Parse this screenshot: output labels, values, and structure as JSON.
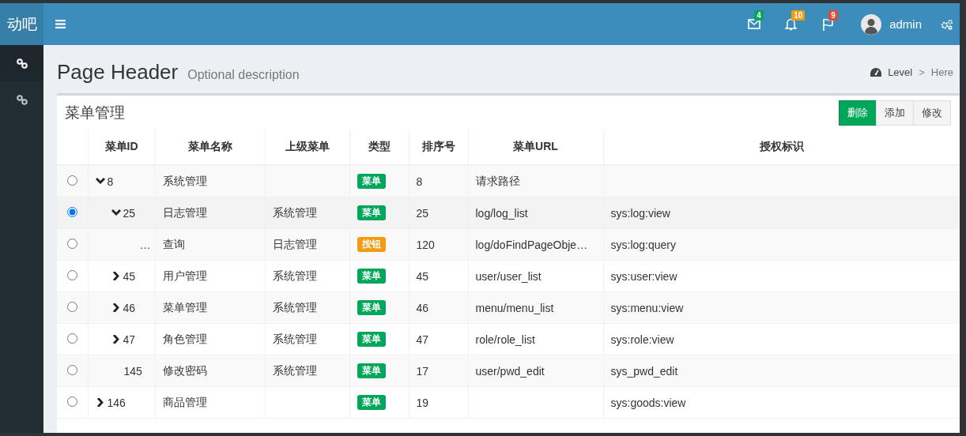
{
  "header": {
    "logo": "动吧",
    "notifications": [
      {
        "kind": "mail",
        "count": "4",
        "color": "#00a65a"
      },
      {
        "kind": "bell",
        "count": "10",
        "color": "#f39c12"
      },
      {
        "kind": "flag",
        "count": "9",
        "color": "#dd4b39"
      }
    ],
    "user": {
      "name": "admin"
    }
  },
  "sidebar": {
    "items": [
      {
        "selected": true
      },
      {
        "selected": false
      }
    ]
  },
  "page_header": {
    "title": "Page Header",
    "description": "Optional description"
  },
  "breadcrumb": {
    "separator": ">",
    "items": [
      {
        "label": "Level",
        "active": false
      },
      {
        "label": "Here",
        "active": true
      }
    ]
  },
  "box": {
    "title": "菜单管理",
    "buttons": [
      {
        "label": "删除",
        "kind": "primary"
      },
      {
        "label": "添加",
        "kind": "default"
      },
      {
        "label": "修改",
        "kind": "default"
      }
    ],
    "table": {
      "columns": [
        "菜单ID",
        "菜单名称",
        "上级菜单",
        "类型",
        "排序号",
        "菜单URL",
        "授权标识"
      ],
      "rows": [
        {
          "id": "8",
          "expanded": true,
          "name": "系统管理",
          "type": {
            "label": "菜单",
            "color": "#00a65a"
          },
          "sort": "8",
          "url": "请求路径",
          "selected": false,
          "children": [
            {
              "id": "25",
              "expanded": true,
              "name": "日志管理",
              "parent": "系统管理",
              "type": {
                "label": "菜单",
                "color": "#00a65a"
              },
              "sort": "25",
              "url": "log/log_list",
              "perm": "sys:log:view",
              "selected": true,
              "children": [
                {
                  "id": "…",
                  "name": "查询",
                  "parent": "日志管理",
                  "type": {
                    "label": "按钮",
                    "color": "#f39c12"
                  },
                  "sort": "120",
                  "url": "log/doFindPageObje…",
                  "perm": "sys:log:query",
                  "selected": false
                }
              ]
            },
            {
              "id": "45",
              "expanded": false,
              "name": "用户管理",
              "parent": "系统管理",
              "type": {
                "label": "菜单",
                "color": "#00a65a"
              },
              "sort": "45",
              "url": "user/user_list",
              "perm": "sys:user:view",
              "selected": false
            },
            {
              "id": "46",
              "expanded": false,
              "name": "菜单管理",
              "parent": "系统管理",
              "type": {
                "label": "菜单",
                "color": "#00a65a"
              },
              "sort": "46",
              "url": "menu/menu_list",
              "perm": "sys:menu:view",
              "selected": false
            },
            {
              "id": "47",
              "expanded": false,
              "name": "角色管理",
              "parent": "系统管理",
              "type": {
                "label": "菜单",
                "color": "#00a65a"
              },
              "sort": "47",
              "url": "role/role_list",
              "perm": "sys:role:view",
              "selected": false
            },
            {
              "id": "145",
              "name": "修改密码",
              "parent": "系统管理",
              "type": {
                "label": "菜单",
                "color": "#00a65a"
              },
              "sort": "17",
              "url": "user/pwd_edit",
              "perm": "sys_pwd_edit",
              "selected": false
            }
          ]
        },
        {
          "id": "146",
          "expanded": false,
          "name": "商品管理",
          "type": {
            "label": "菜单",
            "color": "#00a65a"
          },
          "sort": "19",
          "perm": "sys:goods:view",
          "selected": false
        }
      ]
    }
  }
}
